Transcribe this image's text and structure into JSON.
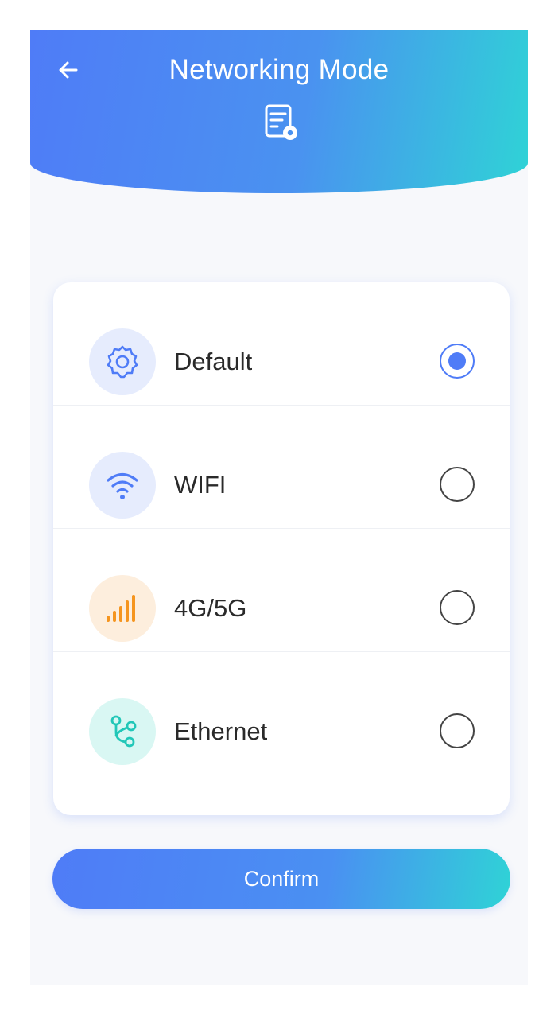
{
  "header": {
    "title": "Networking Mode",
    "back_icon": "arrow-left-icon",
    "title_icon": "document-settings-icon",
    "gradient_start": "#4f7cf7",
    "gradient_end": "#2fd3d6"
  },
  "options": [
    {
      "label": "Default",
      "icon": "gear-icon",
      "icon_bg": "#e6ecfd",
      "icon_color": "#4f7cf7",
      "selected": true
    },
    {
      "label": "WIFI",
      "icon": "wifi-icon",
      "icon_bg": "#e6ecfd",
      "icon_color": "#4f7cf7",
      "selected": false
    },
    {
      "label": "4G/5G",
      "icon": "signal-bars-icon",
      "icon_bg": "#fdeedd",
      "icon_color": "#f5951f",
      "selected": false
    },
    {
      "label": "Ethernet",
      "icon": "network-nodes-icon",
      "icon_bg": "#d9f7f3",
      "icon_color": "#22c7b8",
      "selected": false
    }
  ],
  "confirm": {
    "label": "Confirm"
  }
}
